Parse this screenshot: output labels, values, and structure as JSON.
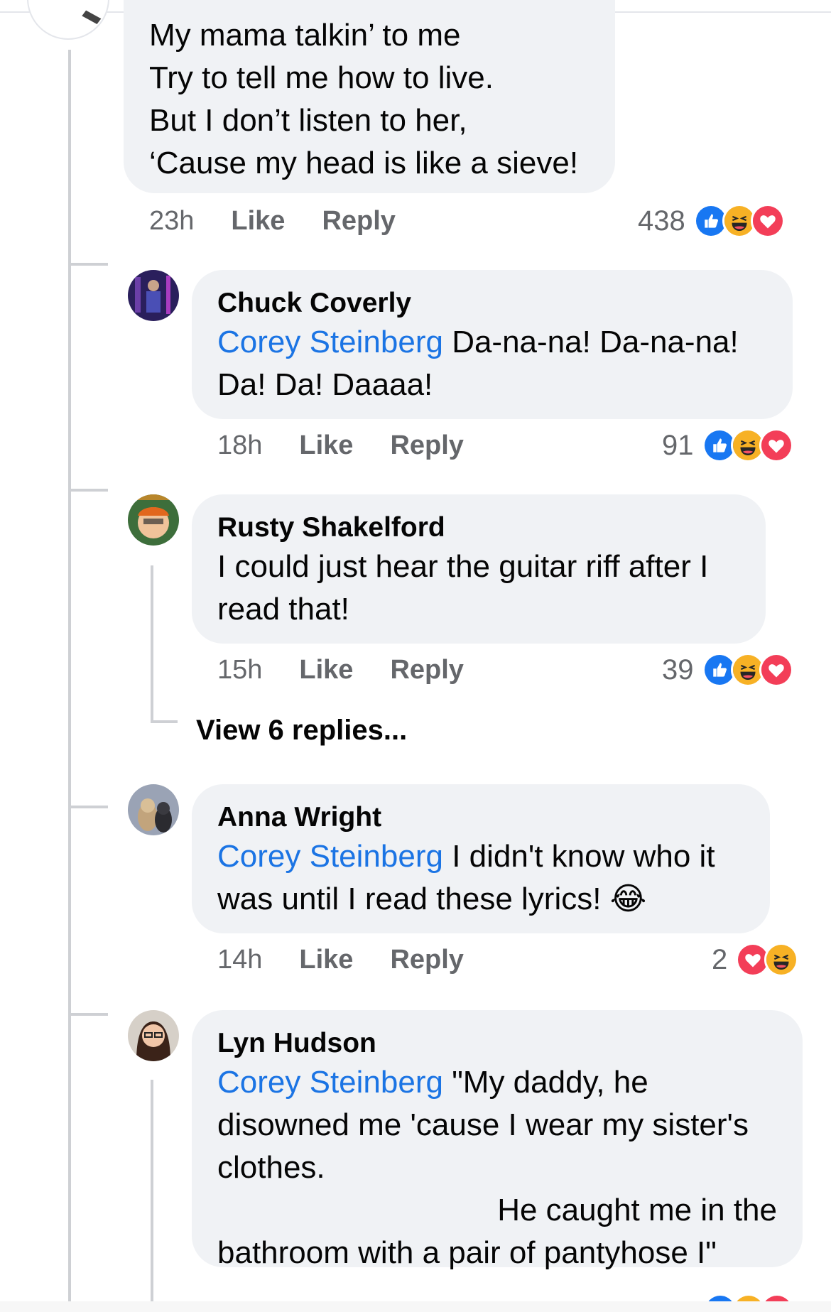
{
  "top_comment": {
    "lines": [
      "My mama talkin’ to me",
      "Try to tell me how to live.",
      "But I don’t listen to her,",
      "‘Cause my head is like a sieve!"
    ],
    "time": "23h",
    "like_label": "Like",
    "reply_label": "Reply",
    "reaction_count": "438",
    "reactions": [
      "like-icon",
      "haha-icon",
      "love-icon"
    ]
  },
  "replies": [
    {
      "author": "Chuck Coverly",
      "mention": "Corey Steinberg",
      "text_line1": "Da-na-na! Da-na-na!",
      "text_line2": "Da! Da! Daaaa!",
      "time": "18h",
      "like_label": "Like",
      "reply_label": "Reply",
      "reaction_count": "91",
      "reactions": [
        "like-icon",
        "haha-icon",
        "love-icon"
      ]
    },
    {
      "author": "Rusty Shakelford",
      "text_line1": "I could just hear the guitar riff after I",
      "text_line2": "read that!",
      "time": "15h",
      "like_label": "Like",
      "reply_label": "Reply",
      "reaction_count": "39",
      "reactions": [
        "like-icon",
        "haha-icon",
        "love-icon"
      ],
      "view_replies": "View 6 replies..."
    },
    {
      "author": "Anna Wright",
      "mention": "Corey Steinberg",
      "text_line1": "I didn't know who it",
      "text_line2": "was until I read these lyrics!",
      "emoji": "😂",
      "time": "14h",
      "like_label": "Like",
      "reply_label": "Reply",
      "reaction_count": "2",
      "reactions": [
        "love-icon",
        "haha-icon"
      ]
    },
    {
      "author": "Lyn Hudson",
      "mention": "Corey Steinberg",
      "text_line1": "\"My daddy, he",
      "text_line2": "disowned me 'cause I wear my sister's",
      "text_line3": "clothes.",
      "text_line4": "He caught me in the",
      "text_line5": "bathroom with a pair of pantyhose I\"",
      "reactions": [
        "like-icon",
        "haha-icon",
        "love-icon"
      ]
    }
  ],
  "colors": {
    "bubble": "#f0f2f5",
    "mention": "#1b74e4",
    "meta": "#65676b",
    "like": "#1877f2",
    "love": "#f33e58",
    "haha": "#f7b125"
  }
}
